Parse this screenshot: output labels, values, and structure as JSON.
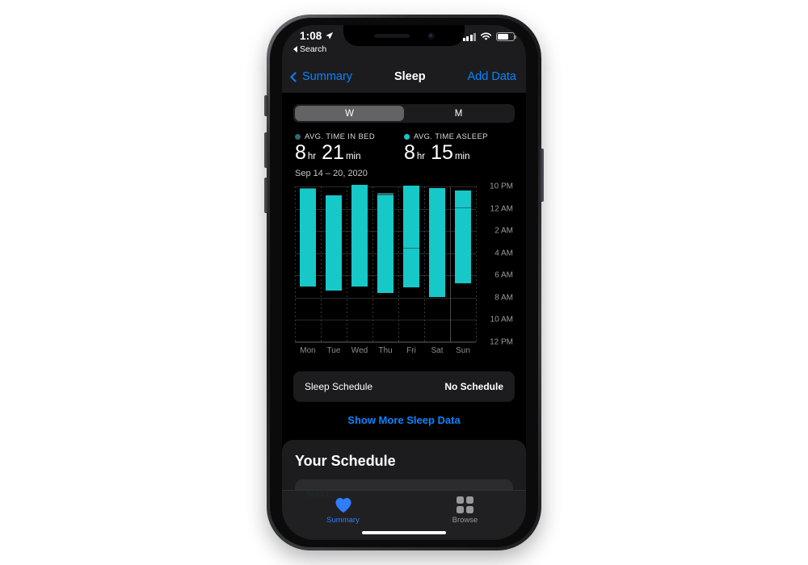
{
  "status_bar": {
    "time": "1:08",
    "location_icon": "location-arrow-icon",
    "back_label": "Search",
    "signal_icon": "cellular-signal-icon",
    "wifi_icon": "wifi-icon",
    "battery_icon": "battery-icon"
  },
  "nav": {
    "back_label": "Summary",
    "title": "Sleep",
    "action_label": "Add Data"
  },
  "segmented": {
    "options": [
      {
        "label": "W",
        "selected": true
      },
      {
        "label": "M",
        "selected": false
      }
    ]
  },
  "stats": [
    {
      "label": "AVG. TIME IN BED",
      "dot_color": "#2a6d73",
      "hours": "8",
      "hours_unit": "hr",
      "minutes": "21",
      "minutes_unit": "min"
    },
    {
      "label": "AVG. TIME ASLEEP",
      "dot_color": "#16c8c8",
      "hours": "8",
      "hours_unit": "hr",
      "minutes": "15",
      "minutes_unit": "min"
    }
  ],
  "date_range": "Sep 14 – 20, 2020",
  "chart_data": {
    "type": "bar",
    "title": "Sleep",
    "xlabel": "",
    "ylabel": "",
    "grid": true,
    "legend_position": "top",
    "categories": [
      "Mon",
      "Tue",
      "Wed",
      "Thu",
      "Fri",
      "Sat",
      "Sun"
    ],
    "ytick_labels": [
      "10 PM",
      "12 AM",
      "2 AM",
      "4 AM",
      "6 AM",
      "8 AM",
      "10 AM",
      "12 PM"
    ],
    "ytick_hours": [
      0,
      2,
      4,
      6,
      8,
      10,
      12,
      14
    ],
    "ylim_hours": [
      0,
      14
    ],
    "series": [
      {
        "name": "Time in Bed",
        "color": "#2a6d73",
        "bars": [
          {
            "category": "Mon",
            "start": "10:10 PM",
            "end": "7:00 AM",
            "start_h": 0.17,
            "end_h": 9.0
          },
          {
            "category": "Tue",
            "start": "10:50 PM",
            "end": "7:20 AM",
            "start_h": 0.83,
            "end_h": 9.33
          },
          {
            "category": "Wed",
            "start": "9:50 PM",
            "end": "7:00 AM",
            "start_h": -0.17,
            "end_h": 9.0
          },
          {
            "category": "Thu",
            "start": "10:35 PM",
            "end": "7:35 AM",
            "start_h": 0.58,
            "end_h": 9.58
          },
          {
            "category": "Fri",
            "start": "9:55 PM",
            "end": "7:05 AM",
            "start_h": -0.08,
            "end_h": 9.08
          },
          {
            "category": "Sat",
            "start": "10:10 PM",
            "end": "7:55 AM",
            "start_h": 0.17,
            "end_h": 9.92
          },
          {
            "category": "Sun",
            "start": "10:20 PM",
            "end": "6:40 AM",
            "start_h": 0.33,
            "end_h": 8.67
          }
        ]
      },
      {
        "name": "Time Asleep",
        "color": "#16c8c8",
        "bars": [
          {
            "category": "Mon",
            "start": "10:15 PM",
            "end": "7:00 AM",
            "start_h": 0.25,
            "end_h": 9.0
          },
          {
            "category": "Tue",
            "start": "10:50 PM",
            "end": "7:20 AM",
            "start_h": 0.83,
            "end_h": 9.33
          },
          {
            "category": "Wed",
            "start": "9:50 PM",
            "end": "7:00 AM",
            "start_h": -0.17,
            "end_h": 9.0
          },
          {
            "category": "Thu",
            "start": "10:50 PM",
            "end": "7:35 AM",
            "start_h": 0.83,
            "end_h": 9.58
          },
          {
            "category": "Fri",
            "start": "9:55 PM",
            "end": "7:05 AM",
            "start_h": -0.08,
            "end_h": 9.08
          },
          {
            "category": "Sat",
            "start": "10:10 PM",
            "end": "7:55 AM",
            "start_h": 0.17,
            "end_h": 9.92
          },
          {
            "category": "Sun",
            "start": "10:20 PM",
            "end": "6:40 AM",
            "start_h": 0.33,
            "end_h": 8.67
          }
        ]
      }
    ],
    "interruptions": [
      {
        "category": "Fri",
        "at": "3:30 AM",
        "at_h": 5.5
      },
      {
        "category": "Sun",
        "at": "11:55 PM",
        "at_h": 1.92
      }
    ]
  },
  "sleep_schedule_row": {
    "key": "Sleep Schedule",
    "value": "No Schedule"
  },
  "show_more": "Show More Sleep Data",
  "your_schedule": {
    "title": "Your Schedule",
    "next_label": "Next"
  },
  "tabbar": {
    "tabs": [
      {
        "label": "Summary",
        "icon": "heart-icon",
        "active": true
      },
      {
        "label": "Browse",
        "icon": "grid-icon",
        "active": false
      }
    ]
  },
  "colors": {
    "accent_blue": "#0a84ff",
    "teal": "#16c8c8",
    "teal_dark": "#2a6d73"
  }
}
